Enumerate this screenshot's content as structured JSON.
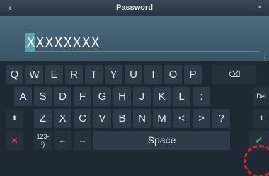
{
  "header": {
    "title": "Password",
    "back_icon": "‹",
    "close_icon": "×"
  },
  "input": {
    "value": "XXXXXXXX",
    "edge_glyph": "("
  },
  "keyboard": {
    "row1": [
      "Q",
      "W",
      "E",
      "R",
      "T",
      "Y",
      "U",
      "I",
      "O",
      "P",
      "⌫"
    ],
    "row2": [
      "A",
      "S",
      "D",
      "F",
      "G",
      "H",
      "J",
      "K",
      "L",
      ":",
      "Del"
    ],
    "row3": [
      "⬆",
      "Z",
      "X",
      "C",
      "V",
      "B",
      "N",
      "M",
      "<",
      ">",
      "?",
      "⬆"
    ],
    "row4": {
      "cancel": "✕",
      "numbers": "123-\n!)",
      "left": "←",
      "right": "→",
      "space": "Space",
      "enter": "✓"
    }
  },
  "colors": {
    "cancel": "#e03a3a",
    "enter": "#3ec25a",
    "highlight": "#e02020"
  }
}
